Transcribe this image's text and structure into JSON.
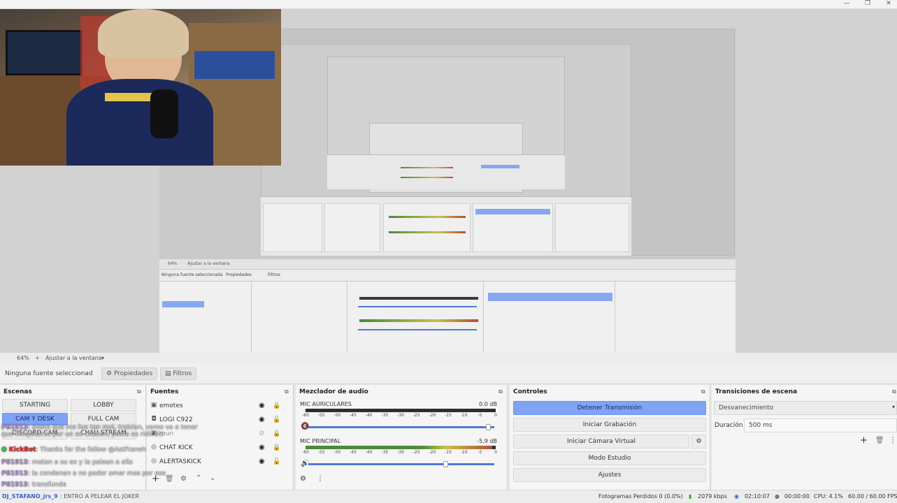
{
  "window": {
    "minimize": "—",
    "maximize": "❐",
    "close": "✕"
  },
  "preview": {
    "inner_toolbar": {
      "zoom": "64%",
      "fit": "Ajustar a la ventana"
    },
    "inner_prop": {
      "no_source": "Ninguna fuente seleccionada",
      "properties": "Propiedades",
      "filters": "Filtros"
    }
  },
  "toolbar": {
    "zoom": "64%",
    "fit": "Ajustar a la ventana",
    "no_source": "Ninguna fuente seleccionad",
    "properties": "Propiedades",
    "filters": "Filtros"
  },
  "scenes": {
    "title": "Escenas",
    "items": [
      "STARTING",
      "LOBBY",
      "CAM Y DESK",
      "FULL CAM",
      "DISCORD CAM",
      "CHAU STREAM"
    ],
    "active": "CAM Y DESK"
  },
  "sources": {
    "title": "Fuentes",
    "items": [
      {
        "label": "emotes",
        "icon": "image-icon"
      },
      {
        "label": "LOGI C922",
        "icon": "camera-icon"
      },
      {
        "label": "mun",
        "icon": "image-icon"
      },
      {
        "label": "CHAT KICK",
        "icon": "browser-icon"
      },
      {
        "label": "ALERTASKICK",
        "icon": "browser-icon"
      }
    ]
  },
  "mixer": {
    "title": "Mezclador de audio",
    "channels": [
      {
        "name": "MIC AURICULARES",
        "db": "0.0 dB",
        "muted": true,
        "level": 0.0,
        "fader": 0.97
      },
      {
        "name": "MIC PRINCIPAL",
        "db": "-5.9 dB",
        "muted": false,
        "level": 0.98,
        "fader": 0.74
      }
    ],
    "ticks": [
      "-60",
      "-55",
      "-50",
      "-45",
      "-40",
      "-35",
      "-30",
      "-25",
      "-20",
      "-15",
      "-10",
      "-5",
      "0"
    ]
  },
  "controls": {
    "title": "Controles",
    "stop_stream": "Detener Transmisión",
    "start_recording": "Iniciar Grabación",
    "start_virtual_cam": "Iniciar Cámara Virtual",
    "studio_mode": "Modo Estudio",
    "settings": "Ajustes"
  },
  "transitions": {
    "title": "Transiciones de escena",
    "selected": "Desvanecimiento",
    "duration_label": "Duración",
    "duration_value": "500 ms"
  },
  "chat": {
    "lines": [
      {
        "user": "P81913",
        "text": ": ahora que me fue tan mal, traicion, vamo va a tener que finiquitarse por un ex chabon, posta es ridiculo"
      },
      {
        "user": "KickBot",
        "text": ": Thanks for the follow @AstFraneh",
        "kick": true
      },
      {
        "user": "P81913",
        "text": ": matan a su ex y la palean a ella"
      },
      {
        "user": "P81913",
        "text": ": la condenan a no poder amar mas por ese"
      },
      {
        "user": "P81913",
        "text": ": transfunde"
      },
      {
        "user": "DJ_STAFANO_jrs_9",
        "text": ": ENTRO A PELEAR EL JOKER"
      }
    ]
  },
  "status": {
    "dropped_frames": "Fotogramas Perdidos 0 (0.0%)",
    "bitrate": "2079 kbps",
    "stream_time": "02:10:07",
    "rec_time": "00:00:00",
    "cpu": "CPU: 4.1%",
    "fps": "60.00 / 60.00 FPS"
  },
  "colors": {
    "accent": "#7fa3f5",
    "meter_green": "#4a8a3a",
    "meter_yellow": "#c7c14a",
    "meter_red": "#b84a3a",
    "mute_red": "#e33b3b"
  }
}
